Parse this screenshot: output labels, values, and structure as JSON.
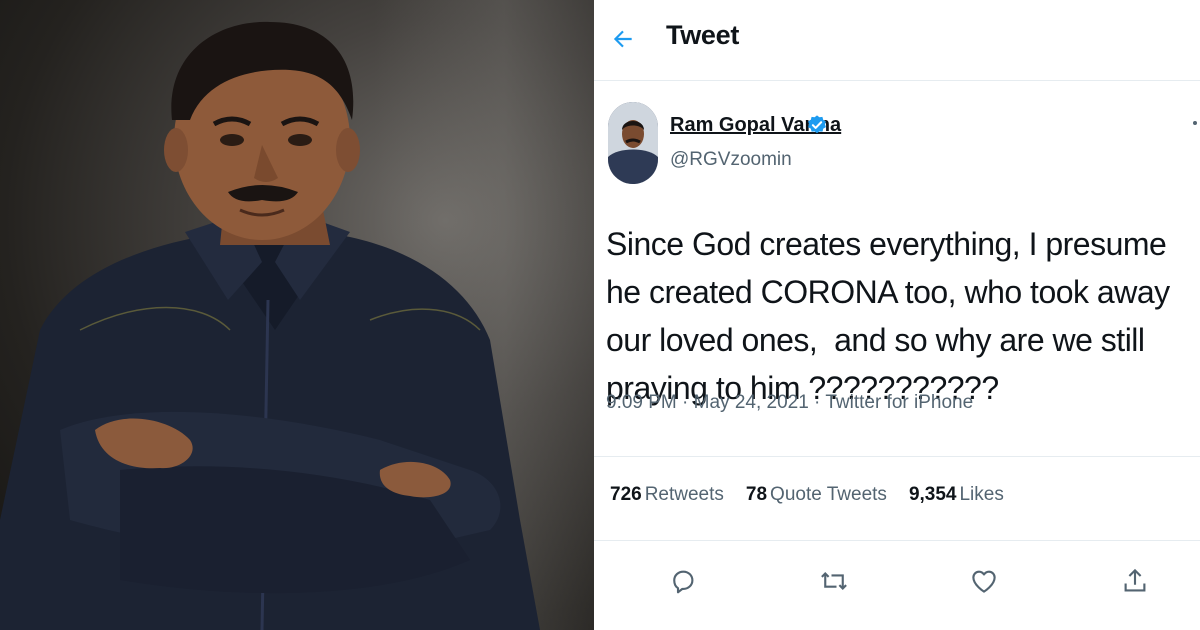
{
  "header": {
    "title": "Tweet",
    "back_icon": "arrow-left-icon"
  },
  "author": {
    "name": "Ram Gopal Varma",
    "handle": "@RGVzoomin",
    "verified": true,
    "verified_icon": "verified-badge-icon"
  },
  "tweet": {
    "text": "Since God creates everything, I presume he created CORONA too, who took away our loved ones,  and so why are we still praying to him ???????????",
    "time": "9:09 PM",
    "date": "May 24, 2021",
    "source": "Twitter for iPhone",
    "meta": "9:09 PM · May 24, 2021 · Twitter for iPhone"
  },
  "stats": {
    "retweets_count": "726",
    "retweets_label": "Retweets",
    "quotes_count": "78",
    "quotes_label": "Quote Tweets",
    "likes_count": "9,354",
    "likes_label": "Likes"
  },
  "actions": [
    "reply-icon",
    "retweet-icon",
    "like-icon",
    "share-icon"
  ],
  "colors": {
    "accent": "#1d9bf0",
    "text": "#0f1419",
    "secondary": "#536471",
    "border": "#e6ecf0"
  }
}
